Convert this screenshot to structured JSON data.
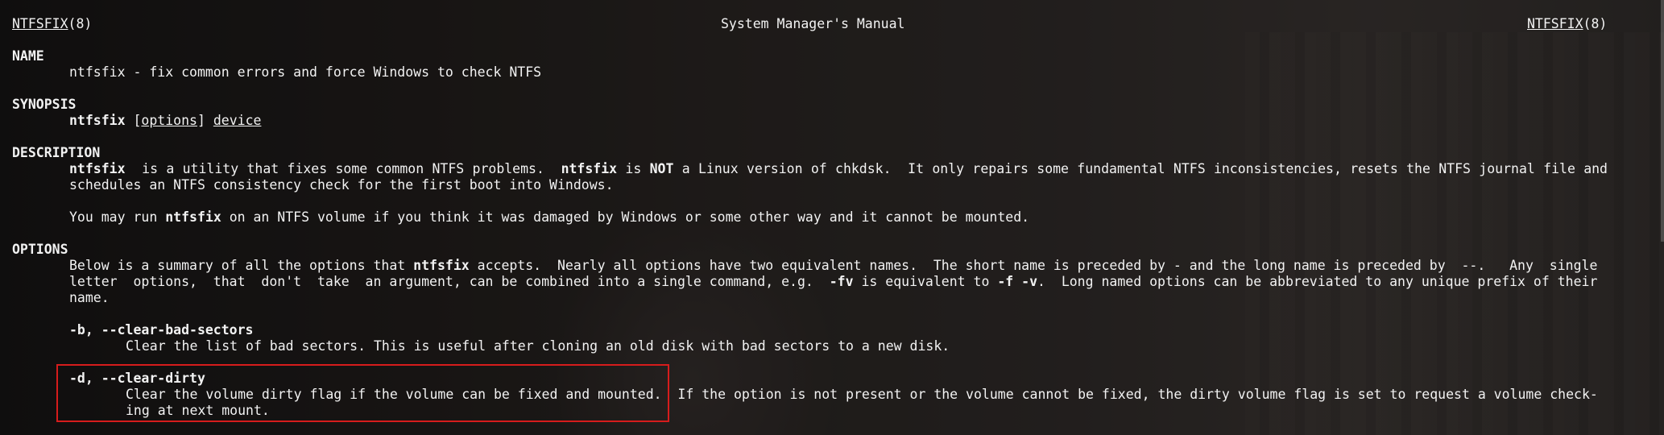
{
  "header": {
    "left_name": "NTFSFIX",
    "left_section": "(8)",
    "center": "System Manager's Manual",
    "right_name": "NTFSFIX",
    "right_section": "(8)"
  },
  "name": {
    "heading": "NAME",
    "text": "ntfsfix - fix common errors and force Windows to check NTFS"
  },
  "synopsis": {
    "heading": "SYNOPSIS",
    "cmd": "ntfsfix",
    "space": " ",
    "lb": "[",
    "options": "options",
    "rb": "]",
    "device": "device"
  },
  "description": {
    "heading": "DESCRIPTION",
    "p1_cmd": "ntfsfix",
    "p1_a": "  is a utility that fixes some common NTFS problems.  ",
    "p1_cmd2": "ntfsfix",
    "p1_b": " is ",
    "p1_not": "NOT",
    "p1_c": " a Linux version of chkdsk.  It only repairs some fundamental NTFS inconsistencies, resets the NTFS journal file and",
    "p1_line2": "schedules an NTFS consistency check for the first boot into Windows.",
    "p2_a": "You may run ",
    "p2_cmd": "ntfsfix",
    "p2_b": " on an NTFS volume if you think it was damaged by Windows or some other way and it cannot be mounted."
  },
  "options": {
    "heading": "OPTIONS",
    "intro_l1_a": "Below is a summary of all the options that ",
    "intro_l1_cmd": "ntfsfix",
    "intro_l1_b": " accepts.  Nearly all options have two equivalent names.  The short name is preceded by - and the long name is preceded by  --.   Any  single",
    "intro_l2_a": "letter  options,  that  don't  take  an argument, can be combined into a single command, e.g.  ",
    "intro_l2_fv": "-fv",
    "intro_l2_b": " is equivalent to ",
    "intro_l2_f": "-f -v",
    "intro_l2_c": ".  Long named options can be abbreviated to any unique prefix of their",
    "intro_l3": "name.",
    "opt_b_flag": "-b, --clear-bad-sectors",
    "opt_b_desc": "Clear the list of bad sectors. This is useful after cloning an old disk with bad sectors to a new disk.",
    "opt_d_flag": "-d, --clear-dirty",
    "opt_d_desc_l1": "Clear the volume dirty flag if the volume can be fixed and mounted.  If the option is not present or the volume cannot be fixed, the dirty volume flag is set to request a volume check-",
    "opt_d_desc_l2": "ing at next mount."
  },
  "colors": {
    "text": "#f2f2f2",
    "highlight_border": "#d61c1c"
  }
}
